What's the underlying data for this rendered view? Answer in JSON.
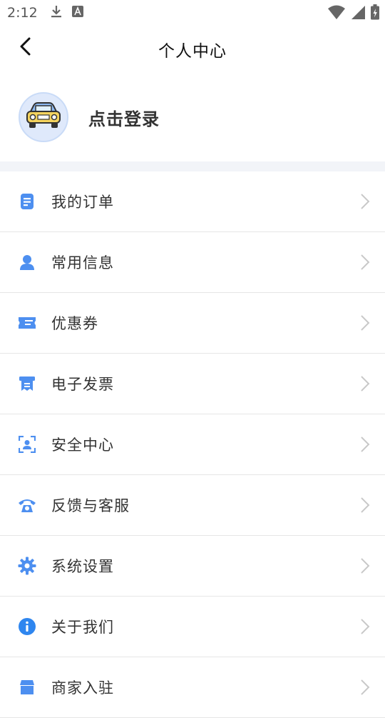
{
  "status_bar": {
    "time": "2:12",
    "left_icons": [
      "download-icon",
      "a-badge-icon"
    ],
    "right_icons": [
      "wifi-icon",
      "signal-icon",
      "battery-icon"
    ]
  },
  "header": {
    "title": "个人中心",
    "back_icon": "chevron-left-icon"
  },
  "profile": {
    "avatar_icon": "car-icon",
    "login_label": "点击登录"
  },
  "colors": {
    "accent": "#4a90e2",
    "icon_blue": "#4d8ff0",
    "band": "#f2f4f8",
    "divider": "#e6e6e6"
  },
  "menu": {
    "items": [
      {
        "label": "我的订单",
        "icon": "order-icon"
      },
      {
        "label": "常用信息",
        "icon": "user-icon"
      },
      {
        "label": "优惠券",
        "icon": "coupon-icon"
      },
      {
        "label": "电子发票",
        "icon": "invoice-icon"
      },
      {
        "label": "安全中心",
        "icon": "face-scan-icon"
      },
      {
        "label": "反馈与客服",
        "icon": "phone-icon"
      },
      {
        "label": "系统设置",
        "icon": "gear-icon"
      },
      {
        "label": "关于我们",
        "icon": "info-icon"
      },
      {
        "label": "商家入驻",
        "icon": "store-icon"
      }
    ]
  }
}
